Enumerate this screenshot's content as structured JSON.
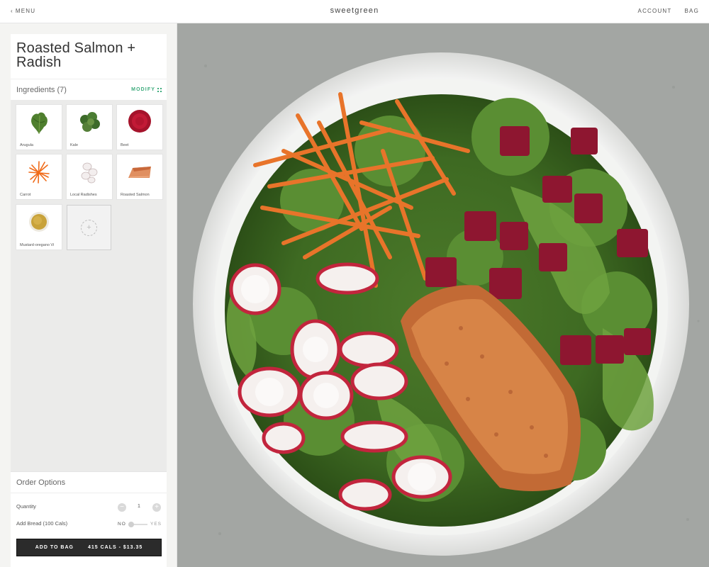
{
  "header": {
    "menu_label": "MENU",
    "brand": "sweetgreen",
    "account_label": "ACCOUNT",
    "bag_label": "BAG"
  },
  "product": {
    "name": "Roasted Salmon + Radish"
  },
  "ingredients": {
    "label": "Ingredients (7)",
    "modify_label": "MODIFY",
    "items": [
      {
        "name": "Arugula",
        "icon": "arugula-icon"
      },
      {
        "name": "Kale",
        "icon": "kale-icon"
      },
      {
        "name": "Beet",
        "icon": "beet-icon"
      },
      {
        "name": "Carrot",
        "icon": "carrot-icon"
      },
      {
        "name": "Local Radishes",
        "icon": "radish-icon"
      },
      {
        "name": "Roasted Salmon",
        "icon": "salmon-icon"
      },
      {
        "name": "Mustard-oregano Vi",
        "icon": "vinaigrette-icon"
      }
    ],
    "add_icon": "plus-icon"
  },
  "order_options": {
    "title": "Order Options",
    "quantity_label": "Quantity",
    "quantity_value": "1",
    "bread_label": "Add Bread (100 Cals)",
    "bread_no": "NO",
    "bread_yes": "YES",
    "bread_selected": "NO",
    "add_to_bag_label": "ADD TO BAG",
    "add_to_bag_summary": "415 CALS - $13.35"
  },
  "colors": {
    "accent": "#3dab7c",
    "button_bg": "#2b2b2b",
    "panel_bg": "#f4f4f2"
  }
}
